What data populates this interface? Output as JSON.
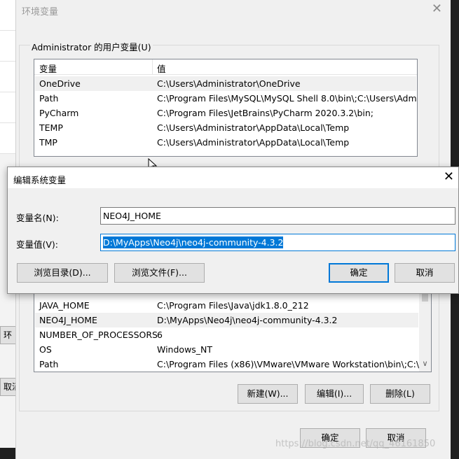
{
  "env_window": {
    "title": "环境变量",
    "user_vars_label": "Administrator 的用户变量(U)",
    "columns": {
      "name": "变量",
      "value": "值"
    },
    "user_vars": [
      {
        "name": "OneDrive",
        "value": "C:\\Users\\Administrator\\OneDrive"
      },
      {
        "name": "Path",
        "value": "C:\\Program Files\\MySQL\\MySQL Shell 8.0\\bin\\;C:\\Users\\Admi..."
      },
      {
        "name": "PyCharm",
        "value": "C:\\Program Files\\JetBrains\\PyCharm 2020.3.2\\bin;"
      },
      {
        "name": "TEMP",
        "value": "C:\\Users\\Administrator\\AppData\\Local\\Temp"
      },
      {
        "name": "TMP",
        "value": "C:\\Users\\Administrator\\AppData\\Local\\Temp"
      }
    ],
    "system_vars": [
      {
        "name": "JAVA_HOME",
        "value": "C:\\Program Files\\Java\\jdk1.8.0_212"
      },
      {
        "name": "NEO4J_HOME",
        "value": "D:\\MyApps\\Neo4j\\neo4j-community-4.3.2"
      },
      {
        "name": "NUMBER_OF_PROCESSORS",
        "value": "6"
      },
      {
        "name": "OS",
        "value": "Windows_NT"
      },
      {
        "name": "Path",
        "value": "C:\\Program Files (x86)\\VMware\\VMware Workstation\\bin\\;C:\\..."
      }
    ],
    "buttons": {
      "new": "新建(W)...",
      "edit": "编辑(I)...",
      "delete": "删除(L)",
      "ok": "确定",
      "cancel": "取消"
    },
    "close_icon": "✕"
  },
  "dialog": {
    "title": "编辑系统变量",
    "name_label": "变量名(N):",
    "name_value": "NEO4J_HOME",
    "value_label": "变量值(V):",
    "value_value": "D:\\MyApps\\Neo4j\\neo4j-community-4.3.2",
    "buttons": {
      "browse_dir": "浏览目录(D)...",
      "browse_file": "浏览文件(F)...",
      "ok": "确定",
      "cancel": "取消"
    },
    "close_icon": "✕"
  },
  "background": {
    "left_fragment_1": "环",
    "left_fragment_2": "取消"
  },
  "watermark": "https://blog.csdn.net/qq_46161850",
  "colors": {
    "accent": "#0078d7",
    "window_bg": "#f0f0f0",
    "selection": "#e5f3ff"
  }
}
